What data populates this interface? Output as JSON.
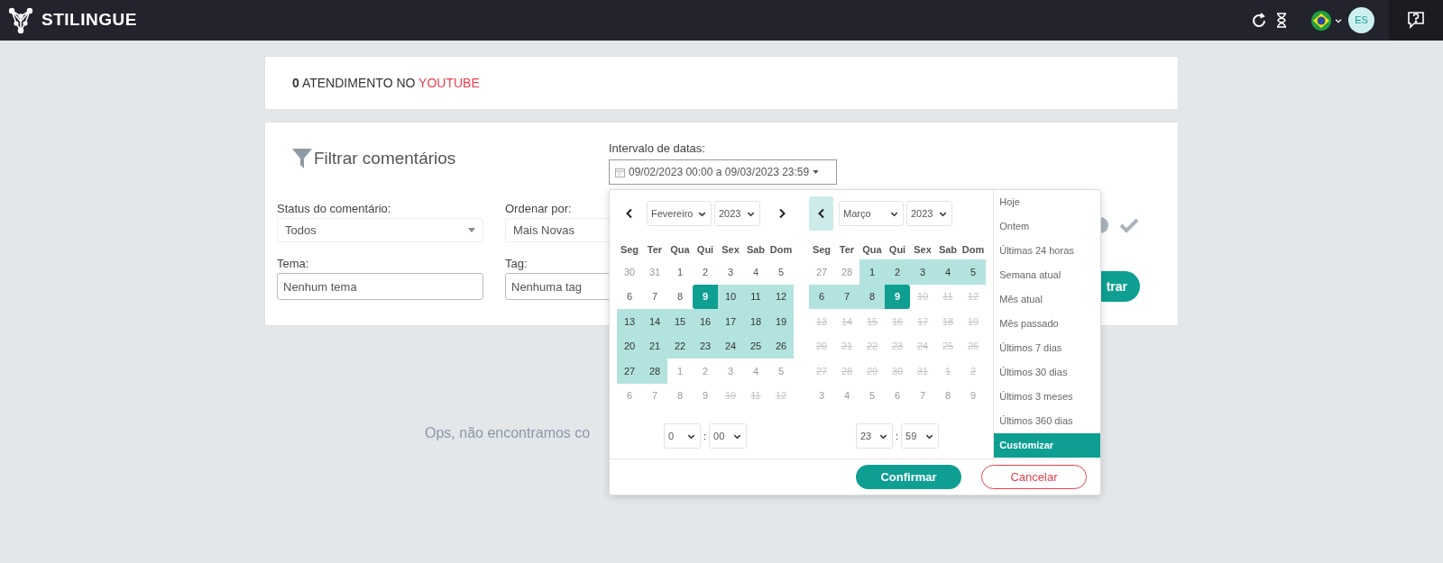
{
  "header": {
    "brand": "STILINGUE",
    "avatar": "ES"
  },
  "summary": {
    "count": "0",
    "text": "ATENDIMENTO NO",
    "network": "YOUTUBE"
  },
  "filter": {
    "title": "Filtrar comentários",
    "date_range": {
      "label": "Intervalo de datas:",
      "value": "09/02/2023 00:00 a 09/03/2023 23:59"
    },
    "fields": [
      {
        "label": "Status do comentário:",
        "kind": "select",
        "value": "Todos"
      },
      {
        "label": "Ordenar por:",
        "kind": "select",
        "value": "Mais Novas"
      },
      {
        "label": "Tema:",
        "kind": "input",
        "placeholder": "Nenhum tema"
      },
      {
        "label": "Tag:",
        "kind": "input",
        "placeholder": "Nenhuma tag"
      }
    ],
    "apply_button": "trar"
  },
  "empty_message": "Ops, não encontramos co",
  "date_picker": {
    "calendars": [
      {
        "month": "Fevereiro",
        "year": "2023",
        "arrows": [
          {
            "kind": "prev",
            "hovered": false
          },
          {
            "kind": "next",
            "hovered": false
          }
        ],
        "weekdays": [
          "Seg",
          "Ter",
          "Qua",
          "Qui",
          "Sex",
          "Sab",
          "Dom"
        ],
        "days": [
          {
            "text": "30",
            "kind": "muted"
          },
          {
            "text": "31",
            "kind": "muted"
          },
          {
            "text": "1",
            "kind": "normal"
          },
          {
            "text": "2",
            "kind": "normal"
          },
          {
            "text": "3",
            "kind": "normal"
          },
          {
            "text": "4",
            "kind": "normal"
          },
          {
            "text": "5",
            "kind": "normal"
          },
          {
            "text": "6",
            "kind": "normal"
          },
          {
            "text": "7",
            "kind": "normal"
          },
          {
            "text": "8",
            "kind": "normal"
          },
          {
            "text": "9",
            "kind": "start"
          },
          {
            "text": "10",
            "kind": "range"
          },
          {
            "text": "11",
            "kind": "range"
          },
          {
            "text": "12",
            "kind": "range"
          },
          {
            "text": "13",
            "kind": "range"
          },
          {
            "text": "14",
            "kind": "range"
          },
          {
            "text": "15",
            "kind": "range"
          },
          {
            "text": "16",
            "kind": "range"
          },
          {
            "text": "17",
            "kind": "range"
          },
          {
            "text": "18",
            "kind": "range"
          },
          {
            "text": "19",
            "kind": "range"
          },
          {
            "text": "20",
            "kind": "range"
          },
          {
            "text": "21",
            "kind": "range"
          },
          {
            "text": "22",
            "kind": "range"
          },
          {
            "text": "23",
            "kind": "range"
          },
          {
            "text": "24",
            "kind": "range"
          },
          {
            "text": "25",
            "kind": "range"
          },
          {
            "text": "26",
            "kind": "range"
          },
          {
            "text": "27",
            "kind": "range"
          },
          {
            "text": "28",
            "kind": "range"
          },
          {
            "text": "1",
            "kind": "muted"
          },
          {
            "text": "2",
            "kind": "muted"
          },
          {
            "text": "3",
            "kind": "muted"
          },
          {
            "text": "4",
            "kind": "muted"
          },
          {
            "text": "5",
            "kind": "muted"
          },
          {
            "text": "6",
            "kind": "muted"
          },
          {
            "text": "7",
            "kind": "muted"
          },
          {
            "text": "8",
            "kind": "muted"
          },
          {
            "text": "9",
            "kind": "muted"
          },
          {
            "text": "10",
            "kind": "disabled"
          },
          {
            "text": "11",
            "kind": "disabled"
          },
          {
            "text": "12",
            "kind": "disabled"
          }
        ],
        "hour": "0",
        "minute": "00"
      },
      {
        "month": "Março",
        "year": "2023",
        "arrows": [
          {
            "kind": "prev",
            "hovered": true
          }
        ],
        "weekdays": [
          "Seg",
          "Ter",
          "Qua",
          "Qui",
          "Sex",
          "Sab",
          "Dom"
        ],
        "days": [
          {
            "text": "27",
            "kind": "muted"
          },
          {
            "text": "28",
            "kind": "muted"
          },
          {
            "text": "1",
            "kind": "range"
          },
          {
            "text": "2",
            "kind": "range"
          },
          {
            "text": "3",
            "kind": "range"
          },
          {
            "text": "4",
            "kind": "range"
          },
          {
            "text": "5",
            "kind": "range"
          },
          {
            "text": "6",
            "kind": "range"
          },
          {
            "text": "7",
            "kind": "range"
          },
          {
            "text": "8",
            "kind": "range"
          },
          {
            "text": "9",
            "kind": "end"
          },
          {
            "text": "10",
            "kind": "disabled"
          },
          {
            "text": "11",
            "kind": "disabled"
          },
          {
            "text": "12",
            "kind": "disabled"
          },
          {
            "text": "13",
            "kind": "disabled"
          },
          {
            "text": "14",
            "kind": "disabled"
          },
          {
            "text": "15",
            "kind": "disabled"
          },
          {
            "text": "16",
            "kind": "disabled"
          },
          {
            "text": "17",
            "kind": "disabled"
          },
          {
            "text": "18",
            "kind": "disabled"
          },
          {
            "text": "19",
            "kind": "disabled"
          },
          {
            "text": "20",
            "kind": "disabled"
          },
          {
            "text": "21",
            "kind": "disabled"
          },
          {
            "text": "22",
            "kind": "disabled"
          },
          {
            "text": "23",
            "kind": "disabled"
          },
          {
            "text": "24",
            "kind": "disabled"
          },
          {
            "text": "25",
            "kind": "disabled"
          },
          {
            "text": "26",
            "kind": "disabled"
          },
          {
            "text": "27",
            "kind": "disabled"
          },
          {
            "text": "28",
            "kind": "disabled"
          },
          {
            "text": "29",
            "kind": "disabled"
          },
          {
            "text": "30",
            "kind": "disabled"
          },
          {
            "text": "31",
            "kind": "disabled"
          },
          {
            "text": "1",
            "kind": "disabled"
          },
          {
            "text": "2",
            "kind": "disabled"
          },
          {
            "text": "3",
            "kind": "muted"
          },
          {
            "text": "4",
            "kind": "muted"
          },
          {
            "text": "5",
            "kind": "muted"
          },
          {
            "text": "6",
            "kind": "muted"
          },
          {
            "text": "7",
            "kind": "muted"
          },
          {
            "text": "8",
            "kind": "muted"
          },
          {
            "text": "9",
            "kind": "muted"
          }
        ],
        "hour": "23",
        "minute": "59"
      }
    ],
    "time_separator": ":",
    "presets": [
      {
        "label": "Hoje",
        "selected": false
      },
      {
        "label": "Ontem",
        "selected": false
      },
      {
        "label": "Últimas 24 horas",
        "selected": false
      },
      {
        "label": "Semana atual",
        "selected": false
      },
      {
        "label": "Mês atual",
        "selected": false
      },
      {
        "label": "Mês passado",
        "selected": false
      },
      {
        "label": "Últimos 7 dias",
        "selected": false
      },
      {
        "label": "Últimos 30 dias",
        "selected": false
      },
      {
        "label": "Últimos 3 meses",
        "selected": false
      },
      {
        "label": "Últimos 360 dias",
        "selected": false
      },
      {
        "label": "Customizar",
        "selected": true
      }
    ],
    "confirm": "Confirmar",
    "cancel": "Cancelar"
  }
}
